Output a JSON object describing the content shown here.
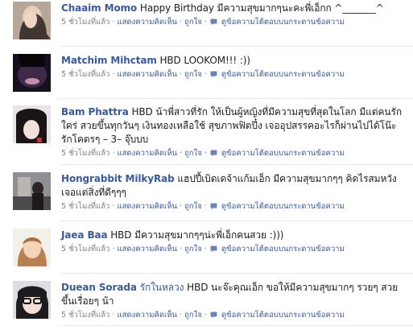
{
  "posts": [
    {
      "name": "Chaaim Momo",
      "text": "Happy Birthday มีความสุขมากๆนะคะพี่เอ็กก ^_______^",
      "time": "5 ชั่วโมงที่แล้ว",
      "comment": "แสดงความคิดเห็น",
      "like": "ถูกใจ",
      "view": "ดูข้อความโต้ตอบบนกระดานข้อความ",
      "dot": "·"
    },
    {
      "name": "Matchim Mihctam",
      "text": "HBD LOOKOM!!! :))",
      "time": "5 ชั่วโมงที่แล้ว",
      "comment": "แสดงความคิดเห็น",
      "like": "ถูกใจ",
      "view": "ดูข้อความโต้ตอบบนกระดานข้อความ",
      "dot": "·"
    },
    {
      "name": "Bam Phattra",
      "text": "HBD น้าพี่สาวที่รัก ให้เป็นผู้หญิงที่มีความสุขที่สุดในโลก มีแต่คนรักใคร่ สวยขึ้นทุกวันๆ เงินทองเหลือใช้ สุขภาพฟิตปึ๋ง เจออุปสรรคอะไรก็ผ่านไปได้โน๊ะ รักโคตรๆ – 3– จุ๊บบบ",
      "time": "5 ชั่วโมงที่แล้ว",
      "comment": "แสดงความคิดเห็น",
      "like": "ถูกใจ",
      "view": "ดูข้อความโต้ตอบบนกระดานข้อความ",
      "dot": "·"
    },
    {
      "name": "Hongrabbit MilkyRab",
      "text": "แฮปปี้เบิดเดจ้าแก้มเอ็ก มีความสุขมากๆๆ คิดไรสมหวังเจอแต่สิ่งที่ดีๆๆๆ",
      "time": "5 ชั่วโมงที่แล้ว",
      "comment": "แสดงความคิดเห็น",
      "like": "ถูกใจ",
      "view": "ดูข้อความโต้ตอบบนกระดานข้อความ",
      "dot": "·"
    },
    {
      "name": "Jaea Baa",
      "text": "HBD มีความสุขมากๆๆน่ะพี่เอ็กคนสวย :)))",
      "time": "5 ชั่วโมงที่แล้ว",
      "comment": "แสดงความคิดเห็น",
      "like": "ถูกใจ",
      "view": "ดูข้อความโต้ตอบบนกระดานข้อความ",
      "dot": "·"
    },
    {
      "name": "Duean Sorada",
      "tag": "รักในหลวง",
      "text": "HBD นะจ๊ะคุณเอ็ก ขอให้มีความสุขมากๆ รวยๆ สวยขึ้นเรื่อยๆ น้า",
      "time": "5 ชั่วโมงที่แล้ว",
      "comment": "แสดงความคิดเห็น",
      "like": "ถูกใจ",
      "view": "ดูข้อความโต้ตอบบนกระดานข้อความ",
      "dot": "·"
    }
  ],
  "colors": {
    "link": "#3b5998",
    "meta": "#808080",
    "divider": "#e5e8ef"
  }
}
